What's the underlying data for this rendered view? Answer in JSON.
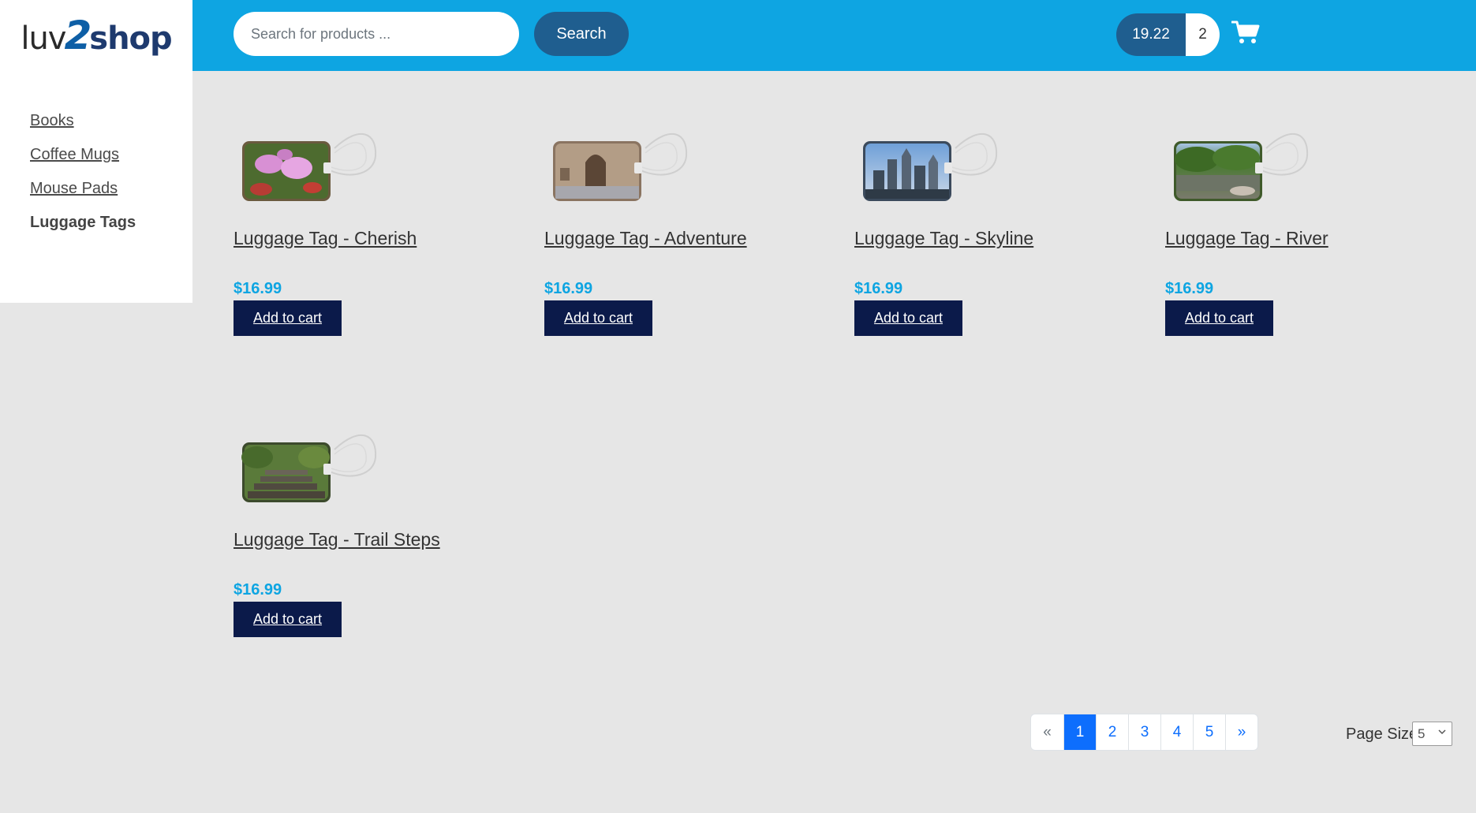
{
  "header": {
    "logo": {
      "part1": "luv",
      "part2": "2",
      "part3": "shop"
    },
    "search": {
      "placeholder": "Search for products ...",
      "button_label": "Search"
    },
    "cart": {
      "total": "19.22",
      "quantity": "2",
      "icon": "shopping-cart-icon"
    }
  },
  "sidebar": {
    "items": [
      {
        "label": "Books",
        "active": false
      },
      {
        "label": "Coffee Mugs",
        "active": false
      },
      {
        "label": "Mouse Pads",
        "active": false
      },
      {
        "label": "Luggage Tags",
        "active": true
      }
    ]
  },
  "products": [
    {
      "name": "Luggage Tag - Cherish",
      "price": "$16.99",
      "button": "Add to cart",
      "image": "orchid-flowers"
    },
    {
      "name": "Luggage Tag - Adventure",
      "price": "$16.99",
      "button": "Add to cart",
      "image": "stone-doorway"
    },
    {
      "name": "Luggage Tag - Skyline",
      "price": "$16.99",
      "button": "Add to cart",
      "image": "city-skyline"
    },
    {
      "name": "Luggage Tag - River",
      "price": "$16.99",
      "button": "Add to cart",
      "image": "river-trees"
    },
    {
      "name": "Luggage Tag - Trail Steps",
      "price": "$16.99",
      "button": "Add to cart",
      "image": "trail-steps"
    }
  ],
  "pagination": {
    "prev": "«",
    "pages": [
      "1",
      "2",
      "3",
      "4",
      "5"
    ],
    "active_page": "1",
    "next": "»"
  },
  "page_size": {
    "label": "Page Size",
    "value": "5"
  },
  "colors": {
    "header_bg": "#0ea5e2",
    "search_button": "#1f5e8f",
    "add_to_cart": "#0b1a4a",
    "price": "#0ea5e2",
    "page_active": "#0d6efd"
  }
}
